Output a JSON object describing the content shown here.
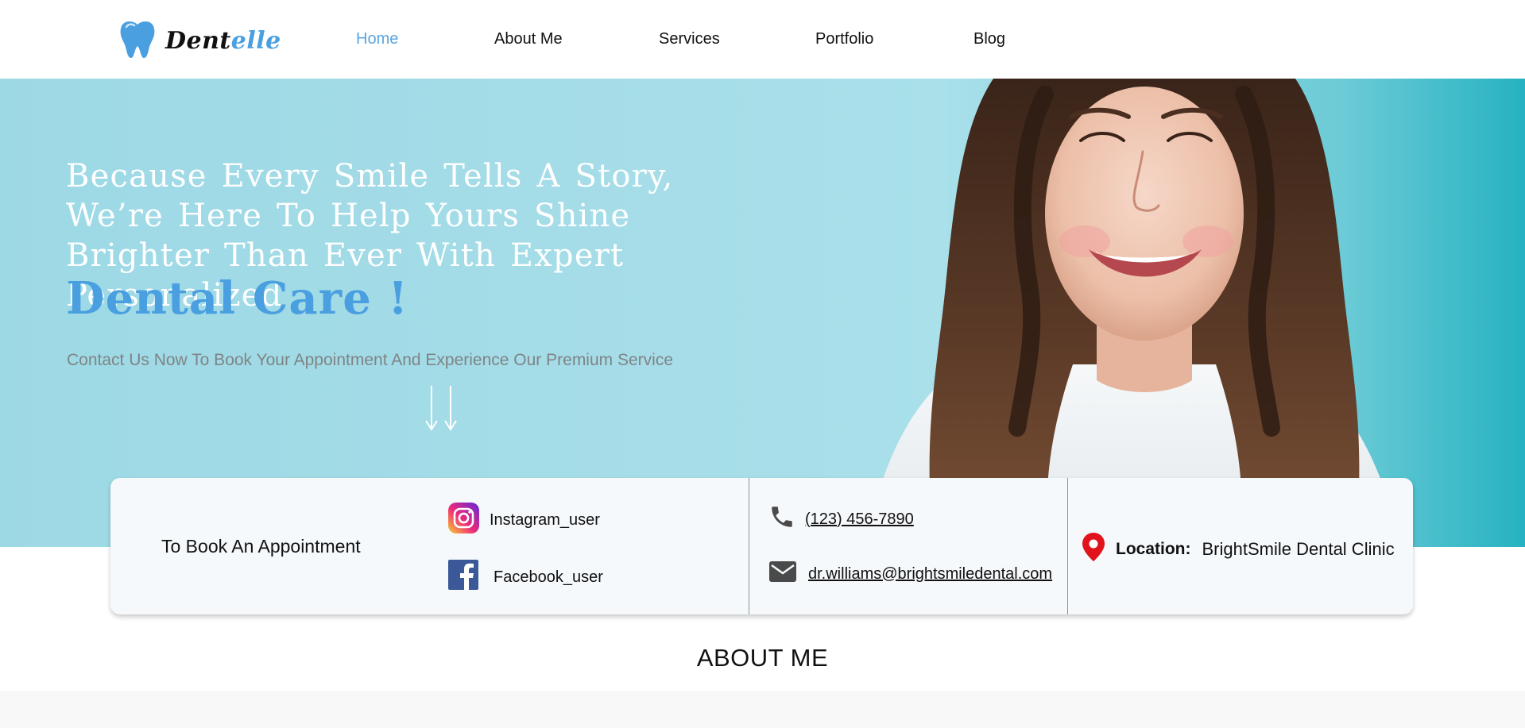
{
  "brand": {
    "name_part1": "Dent",
    "name_part2": "elle",
    "logo_icon": "tooth-icon",
    "dark_color": "#111111",
    "accent_color": "#4a9fe0"
  },
  "nav": {
    "items": [
      {
        "label": "Home",
        "active": true
      },
      {
        "label": "About Me",
        "active": false
      },
      {
        "label": "Services",
        "active": false
      },
      {
        "label": "Portfolio",
        "active": false
      },
      {
        "label": "Blog",
        "active": false
      }
    ],
    "active_color": "#5aa6e0"
  },
  "hero": {
    "headline": "Because Every Smile Tells A Story, We’re Here To Help Yours Shine Brighter Than Ever With Expert Personalized",
    "accent": "Dental Care !",
    "subtext": "Contact Us Now To Book Your Appointment And Experience Our Premium Service",
    "scroll_icon": "double-arrow-down-icon",
    "background_color": "#a6dde8"
  },
  "contact_card": {
    "title": "To Book An Appointment",
    "instagram": {
      "icon": "instagram-icon",
      "label": "Instagram_user"
    },
    "facebook": {
      "icon": "facebook-icon",
      "label": "Facebook_user"
    },
    "phone": {
      "icon": "phone-icon",
      "label": "(123) 456-7890"
    },
    "email": {
      "icon": "mail-icon",
      "label": "dr.williams@brightsmiledental.com"
    },
    "location": {
      "icon": "location-pin-icon",
      "label": "Location:",
      "value": "BrightSmile Dental Clinic"
    }
  },
  "about": {
    "title": "ABOUT ME"
  }
}
